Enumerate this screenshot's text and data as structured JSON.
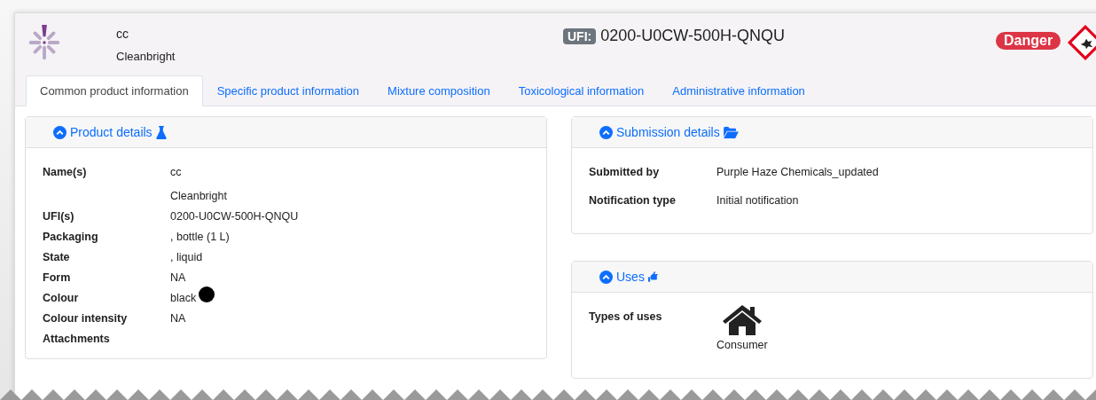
{
  "product": {
    "name": "cc",
    "brand": "Cleanbright"
  },
  "ufi": {
    "label": "UFI:",
    "value": "0200-U0CW-500H-QNQU"
  },
  "signal_word": "Danger",
  "tabs": [
    {
      "label": "Common product information",
      "selected": true
    },
    {
      "label": "Specific product information",
      "selected": false
    },
    {
      "label": "Mixture composition",
      "selected": false
    },
    {
      "label": "Toxicological information",
      "selected": false
    },
    {
      "label": "Administrative information",
      "selected": false
    }
  ],
  "product_details": {
    "title": "Product details",
    "rows": [
      {
        "label": "Name(s)",
        "values": [
          "cc",
          "Cleanbright"
        ]
      },
      {
        "label": "UFI(s)",
        "values": [
          "0200-U0CW-500H-QNQU"
        ]
      },
      {
        "label": "Packaging",
        "values": [
          ", bottle (1 L)"
        ]
      },
      {
        "label": "State",
        "values": [
          ", liquid"
        ]
      },
      {
        "label": "Form",
        "values": [
          "NA"
        ]
      },
      {
        "label": "Colour",
        "values": [
          "black"
        ],
        "color": "#000000"
      },
      {
        "label": "Colour intensity",
        "values": [
          "NA"
        ]
      },
      {
        "label": "Attachments",
        "values": []
      }
    ]
  },
  "submission_details": {
    "title": "Submission details",
    "rows": [
      {
        "label": "Submitted by",
        "value": "Purple Haze Chemicals_updated"
      },
      {
        "label": "Notification type",
        "value": "Initial notification"
      }
    ]
  },
  "uses": {
    "title": "Uses",
    "label": "Types of uses",
    "items": [
      {
        "label": "Consumer"
      }
    ]
  }
}
